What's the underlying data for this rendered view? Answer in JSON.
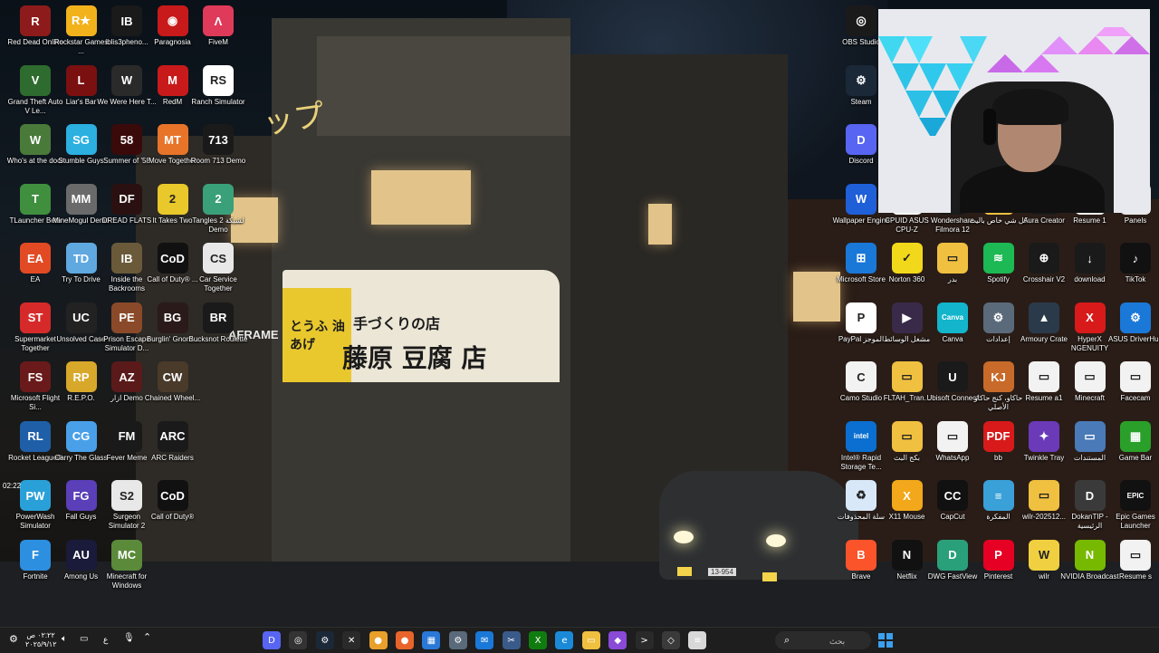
{
  "desktop": {
    "left_columns": [
      [
        {
          "label": "Red Dead Online",
          "icon": "rdr-icon",
          "bg": "#8e1b1b",
          "glyph": "R"
        },
        {
          "label": "Grand Theft Auto V Le...",
          "icon": "gta-icon",
          "bg": "#2e6b2e",
          "glyph": "V"
        },
        {
          "label": "Who's at the door",
          "icon": "door-icon",
          "bg": "#4a7a3a",
          "glyph": "W"
        },
        {
          "label": "TLauncher Beta",
          "icon": "tlauncher-icon",
          "bg": "#3f8f3f",
          "glyph": "T"
        },
        {
          "label": "EA",
          "icon": "ea-icon",
          "bg": "#e24a24",
          "glyph": "EA"
        },
        {
          "label": "Supermarket Together",
          "icon": "supermarket-icon",
          "bg": "#d62a2a",
          "glyph": "ST"
        },
        {
          "label": "Microsoft Flight Si...",
          "icon": "flight-sim-icon",
          "bg": "#6a1a1a",
          "glyph": "FS"
        },
        {
          "label": "Rocket League®",
          "icon": "rocket-league-icon",
          "bg": "#1f5fa8",
          "glyph": "RL"
        },
        {
          "label": "PowerWash Simulator",
          "icon": "powerwash-icon",
          "bg": "#2aa0d8",
          "glyph": "PW"
        },
        {
          "label": "Fortnite",
          "icon": "fortnite-icon",
          "bg": "#2d8fe0",
          "glyph": "F"
        }
      ],
      [
        {
          "label": "Rockstar Games ...",
          "icon": "rockstar-icon",
          "bg": "#f2b21c",
          "glyph": "R★"
        },
        {
          "label": "Liar's Bar",
          "icon": "liars-bar-icon",
          "bg": "#7a1010",
          "glyph": "L"
        },
        {
          "label": "Stumble Guys",
          "icon": "stumble-icon",
          "bg": "#2bb0e0",
          "glyph": "SG"
        },
        {
          "label": "MineMogul Demo",
          "icon": "minemogul-icon",
          "bg": "#6a6a6a",
          "glyph": "MM"
        },
        {
          "label": "Try To Drive",
          "icon": "drive-icon",
          "bg": "#5fa8e0",
          "glyph": "TD"
        },
        {
          "label": "Unsolved Case",
          "icon": "unsolved-icon",
          "bg": "#222222",
          "glyph": "UC"
        },
        {
          "label": "R.E.P.O.",
          "icon": "repo-icon",
          "bg": "#d8a82a",
          "glyph": "RP"
        },
        {
          "label": "Carry The Glass",
          "icon": "glass-icon",
          "bg": "#4aa0e8",
          "glyph": "CG"
        },
        {
          "label": "Fall Guys",
          "icon": "fallguys-icon",
          "bg": "#5a3fb8",
          "glyph": "FG"
        },
        {
          "label": "Among Us",
          "icon": "amongus-icon",
          "bg": "#1a1a3a",
          "glyph": "AU"
        }
      ],
      [
        {
          "label": "iblis3pheno...",
          "icon": "iblis-icon",
          "bg": "#1a1a1a",
          "glyph": "IB"
        },
        {
          "label": "We Were Here T...",
          "icon": "we-were-here-icon",
          "bg": "#2a2a2a",
          "glyph": "W"
        },
        {
          "label": "Summer of '58",
          "icon": "summer58-icon",
          "bg": "#3a0a0a",
          "glyph": "58"
        },
        {
          "label": "DREAD FLATS",
          "icon": "dread-flats-icon",
          "bg": "#2a1010",
          "glyph": "DF"
        },
        {
          "label": "Inside the Backrooms",
          "icon": "backrooms-icon",
          "bg": "#6a5a3a",
          "glyph": "IB"
        },
        {
          "label": "Prison Escape Simulator D...",
          "icon": "prison-icon",
          "bg": "#8a4a2a",
          "glyph": "PE"
        },
        {
          "label": "ازار Demo",
          "icon": "azar-icon",
          "bg": "#5a1a1a",
          "glyph": "AZ"
        },
        {
          "label": "Fever Meme",
          "icon": "fever-meme-icon",
          "bg": "#1a1a1a",
          "glyph": "FM"
        },
        {
          "label": "Surgeon Simulator 2",
          "icon": "surgeon-icon",
          "bg": "#e8e8e8",
          "glyph": "S2"
        },
        {
          "label": "Minecraft for Windows",
          "icon": "minecraft-win-icon",
          "bg": "#5a8a3a",
          "glyph": "MC"
        }
      ],
      [
        {
          "label": "Paragnosia",
          "icon": "paragnosia-icon",
          "bg": "#c81a1a",
          "glyph": "◉"
        },
        {
          "label": "RedM",
          "icon": "redm-icon",
          "bg": "#c81a1a",
          "glyph": "M"
        },
        {
          "label": "Move Together",
          "icon": "move-together-icon",
          "bg": "#e8742a",
          "glyph": "MT"
        },
        {
          "label": "It Takes Two",
          "icon": "it-takes-two-icon",
          "bg": "#e8c82a",
          "glyph": "2"
        },
        {
          "label": "Call of Duty® ...",
          "icon": "cod-icon",
          "bg": "#111111",
          "glyph": "CoD"
        },
        {
          "label": "Burglin' Gnom...",
          "icon": "burglin-icon",
          "bg": "#2a1a1a",
          "glyph": "BG"
        },
        {
          "label": "Chained Wheel...",
          "icon": "chained-icon",
          "bg": "#4a3a2a",
          "glyph": "CW"
        },
        {
          "label": "ARC Raiders",
          "icon": "arc-raiders-icon",
          "bg": "#1a1a1a",
          "glyph": "ARC"
        },
        {
          "label": "Call of Duty®",
          "icon": "cod2-icon",
          "bg": "#111111",
          "glyph": "CoD"
        }
      ],
      [
        {
          "label": "FiveM",
          "icon": "fivem-icon",
          "bg": "#e03a5a",
          "glyph": "Λ"
        },
        {
          "label": "Ranch Simulator",
          "icon": "ranch-icon",
          "bg": "#ffffff",
          "glyph": "RS"
        },
        {
          "label": "Room 713 Demo",
          "icon": "room713-icon",
          "bg": "#1a1a1a",
          "glyph": "713"
        },
        {
          "label": "Tangles 2 لشبكة Demo",
          "icon": "tangles-icon",
          "bg": "#3aa07a",
          "glyph": "2"
        },
        {
          "label": "Car Service Together",
          "icon": "car-service-icon",
          "bg": "#e8e8e8",
          "glyph": "CS"
        },
        {
          "label": "Bucksnot Roulette",
          "icon": "bucksnot-icon",
          "bg": "#1a1a1a",
          "glyph": "BR"
        }
      ]
    ],
    "right_columns": [
      [
        {
          "label": "OBS Studio",
          "icon": "obs-icon",
          "bg": "#1a1a1a",
          "glyph": "◎"
        },
        {
          "label": "Steam",
          "icon": "steam-icon",
          "bg": "#1b2838",
          "glyph": "⚙"
        },
        {
          "label": "Discord",
          "icon": "discord-icon",
          "bg": "#5865f2",
          "glyph": "D"
        },
        {
          "label": "Wallpaper Engine",
          "icon": "wallpaper-engine-icon",
          "bg": "#1f5fd8",
          "glyph": "W"
        },
        {
          "label": "Microsoft Store",
          "icon": "ms-store-icon",
          "bg": "#1a78d8",
          "glyph": "⊞"
        },
        {
          "label": "PayPal الموجز",
          "icon": "paypal-icon",
          "bg": "#ffffff",
          "glyph": "P"
        },
        {
          "label": "Camo Studio",
          "icon": "camo-icon",
          "bg": "#f2f2f2",
          "glyph": "C"
        },
        {
          "label": "Intel® Rapid Storage Te...",
          "icon": "intel-icon",
          "bg": "#0a6fd0",
          "glyph": "intel"
        },
        {
          "label": "سلة المحذوفات",
          "icon": "recycle-bin-icon",
          "bg": "#d8e8f8",
          "glyph": "♻"
        },
        {
          "label": "Brave",
          "icon": "brave-icon",
          "bg": "#fb542b",
          "glyph": "B"
        }
      ],
      [
        {
          "label": "CPUID ASUS CPU-Z",
          "icon": "cpuz-icon",
          "bg": "#ffffff",
          "glyph": "Z"
        },
        {
          "label": "Norton 360",
          "icon": "norton-icon",
          "bg": "#f2d81a",
          "glyph": "✓"
        },
        {
          "label": "مشغل الوسائط",
          "icon": "media-player-icon",
          "bg": "#3a2a4a",
          "glyph": "▶"
        },
        {
          "label": "FLTAH_Tran...",
          "icon": "folder-icon",
          "bg": "#f0c040",
          "glyph": "▭"
        },
        {
          "label": "بكج البث",
          "icon": "folder2-icon",
          "bg": "#f0c040",
          "glyph": "▭"
        },
        {
          "label": "X11 Mouse",
          "icon": "x11-icon",
          "bg": "#f2a81a",
          "glyph": "X"
        },
        {
          "label": "Netflix",
          "icon": "netflix-icon",
          "bg": "#111111",
          "glyph": "N"
        }
      ],
      [
        {
          "label": "Wondershare Filmora 12",
          "icon": "filmora-icon",
          "bg": "#1a1a1a",
          "glyph": "F"
        },
        {
          "label": "بدر",
          "icon": "folder3-icon",
          "bg": "#f0c040",
          "glyph": "▭"
        },
        {
          "label": "Canva",
          "icon": "canva-icon",
          "bg": "#12b5cb",
          "glyph": "Canva"
        },
        {
          "label": "Ubisoft Connect",
          "icon": "ubisoft-icon",
          "bg": "#1a1a1a",
          "glyph": "U"
        },
        {
          "label": "WhatsApp",
          "icon": "whatsapp-file-icon",
          "bg": "#f2f2f2",
          "glyph": "▭"
        },
        {
          "label": "CapCut",
          "icon": "capcut-icon",
          "bg": "#111111",
          "glyph": "CC"
        },
        {
          "label": "DWG FastView",
          "icon": "dwg-icon",
          "bg": "#2aa07a",
          "glyph": "D"
        }
      ],
      [
        {
          "label": "كل شي خاص باليث",
          "icon": "folder4-icon",
          "bg": "#f0c040",
          "glyph": "▭"
        },
        {
          "label": "Spotify",
          "icon": "spotify-icon",
          "bg": "#1db954",
          "glyph": "≋"
        },
        {
          "label": "إعدادات",
          "icon": "settings-icon",
          "bg": "#5a6a7a",
          "glyph": "⚙"
        },
        {
          "label": "حاكاو، كنج حاكاو الأصلي",
          "icon": "game-icon",
          "bg": "#c86a2a",
          "glyph": "KJ"
        },
        {
          "label": "bb",
          "icon": "pdf-icon",
          "bg": "#d81a1a",
          "glyph": "PDF"
        },
        {
          "label": "المفكرة",
          "icon": "notepad-icon",
          "bg": "#3aa0d8",
          "glyph": "≡"
        },
        {
          "label": "Pinterest",
          "icon": "pinterest-icon",
          "bg": "#e60023",
          "glyph": "P"
        }
      ],
      [
        {
          "label": "Aura Creator",
          "icon": "aura-icon",
          "bg": "#1a1a1a",
          "glyph": "A"
        },
        {
          "label": "Crosshair V2",
          "icon": "crosshair-icon",
          "bg": "#1a1a1a",
          "glyph": "⊕"
        },
        {
          "label": "Armoury Crate",
          "icon": "armoury-icon",
          "bg": "#2a3a4a",
          "glyph": "▲"
        },
        {
          "label": "Resume a1",
          "icon": "resume-doc-icon",
          "bg": "#f2f2f2",
          "glyph": "▭"
        },
        {
          "label": "Twinkle Tray",
          "icon": "twinkle-icon",
          "bg": "#6a3ab8",
          "glyph": "✦"
        },
        {
          "label": "wilr-202512...",
          "icon": "zip-icon",
          "bg": "#f0c040",
          "glyph": "▭"
        },
        {
          "label": "wilr",
          "icon": "wilr-icon",
          "bg": "#f0d040",
          "glyph": "W"
        }
      ],
      [
        {
          "label": "Resume 1",
          "icon": "resume1-icon",
          "bg": "#f2f2f2",
          "glyph": "▭"
        },
        {
          "label": "download",
          "icon": "download-icon",
          "bg": "#1a1a1a",
          "glyph": "↓"
        },
        {
          "label": "HyperX NGENUITY",
          "icon": "hyperx-icon",
          "bg": "#d81a1a",
          "glyph": "X"
        },
        {
          "label": "Minecraft",
          "icon": "minecraft-doc-icon",
          "bg": "#f2f2f2",
          "glyph": "▭"
        },
        {
          "label": "المستندات",
          "icon": "documents-icon",
          "bg": "#4a7ab8",
          "glyph": "▭"
        },
        {
          "label": "DokanTIP - الرئيسية",
          "icon": "dokantip-icon",
          "bg": "#3a3a3a",
          "glyph": "D"
        },
        {
          "label": "NVIDIA Broadcast",
          "icon": "nvidia-icon",
          "bg": "#76b900",
          "glyph": "N"
        }
      ],
      [
        {
          "label": "Panels",
          "icon": "panels-icon",
          "bg": "#e8e8e8",
          "glyph": "▭"
        },
        {
          "label": "TikTok",
          "icon": "tiktok-icon",
          "bg": "#111111",
          "glyph": "♪"
        },
        {
          "label": "ASUS DriverHub",
          "icon": "asus-driver-icon",
          "bg": "#1a78d8",
          "glyph": "⚙"
        },
        {
          "label": "Facecam",
          "icon": "facecam-icon",
          "bg": "#f2f2f2",
          "glyph": "▭"
        },
        {
          "label": "Game Bar",
          "icon": "gamebar-icon",
          "bg": "#2aa02a",
          "glyph": "▦"
        },
        {
          "label": "Epic Games Launcher",
          "icon": "epic-icon",
          "bg": "#111111",
          "glyph": "EPIC"
        },
        {
          "label": "Resume s",
          "icon": "resume-s-icon",
          "bg": "#f2f2f2",
          "glyph": "▭"
        }
      ]
    ]
  },
  "wallpaper": {
    "shop_sign_main": "藤原 豆腐 店",
    "shop_sign_top": "手づくりの店",
    "shop_sign_side": "とうふ 油あげ",
    "wall_text": "ップ",
    "plate": "13-954",
    "side_sign": "AFRAME"
  },
  "webcam": {
    "label": "webcam overlay"
  },
  "floating_clock": "02:22",
  "taskbar": {
    "search_placeholder": "بحث",
    "time": "٠٢:٢٢ ص",
    "date": "٢٠٢٥/٩/١٢",
    "lang": "ع",
    "pinned": [
      {
        "name": "discord-taskbar-icon",
        "bg": "#5865f2",
        "glyph": "D"
      },
      {
        "name": "obs-taskbar-icon",
        "bg": "#333",
        "glyph": "◎"
      },
      {
        "name": "steam-taskbar-icon",
        "bg": "#1b2838",
        "glyph": "⚙"
      },
      {
        "name": "capcut-taskbar-icon",
        "bg": "#2a2a2a",
        "glyph": "✕"
      },
      {
        "name": "chrome-taskbar-icon",
        "bg": "#e8a02a",
        "glyph": "●"
      },
      {
        "name": "firefox-taskbar-icon",
        "bg": "#e8642a",
        "glyph": "●"
      },
      {
        "name": "photos-taskbar-icon",
        "bg": "#2a78d8",
        "glyph": "▦"
      },
      {
        "name": "settings-taskbar-icon",
        "bg": "#5a6a7a",
        "glyph": "⚙"
      },
      {
        "name": "mail-taskbar-icon",
        "bg": "#1a78d8",
        "glyph": "✉"
      },
      {
        "name": "snip-taskbar-icon",
        "bg": "#3a5a8a",
        "glyph": "✂"
      },
      {
        "name": "xbox-taskbar-icon",
        "bg": "#107c10",
        "glyph": "X"
      },
      {
        "name": "edge-taskbar-icon",
        "bg": "#1a8ad8",
        "glyph": "e"
      },
      {
        "name": "explorer-taskbar-icon",
        "bg": "#f0c040",
        "glyph": "▭"
      },
      {
        "name": "copilot-taskbar-icon",
        "bg": "#8a4ad8",
        "glyph": "◆"
      },
      {
        "name": "terminal-taskbar-icon",
        "bg": "#2a2a2a",
        "glyph": ">"
      },
      {
        "name": "store-taskbar-icon",
        "bg": "#3a3a3a",
        "glyph": "◇"
      },
      {
        "name": "notepad-taskbar-icon",
        "bg": "#d8d8d8",
        "glyph": "≡"
      }
    ]
  }
}
